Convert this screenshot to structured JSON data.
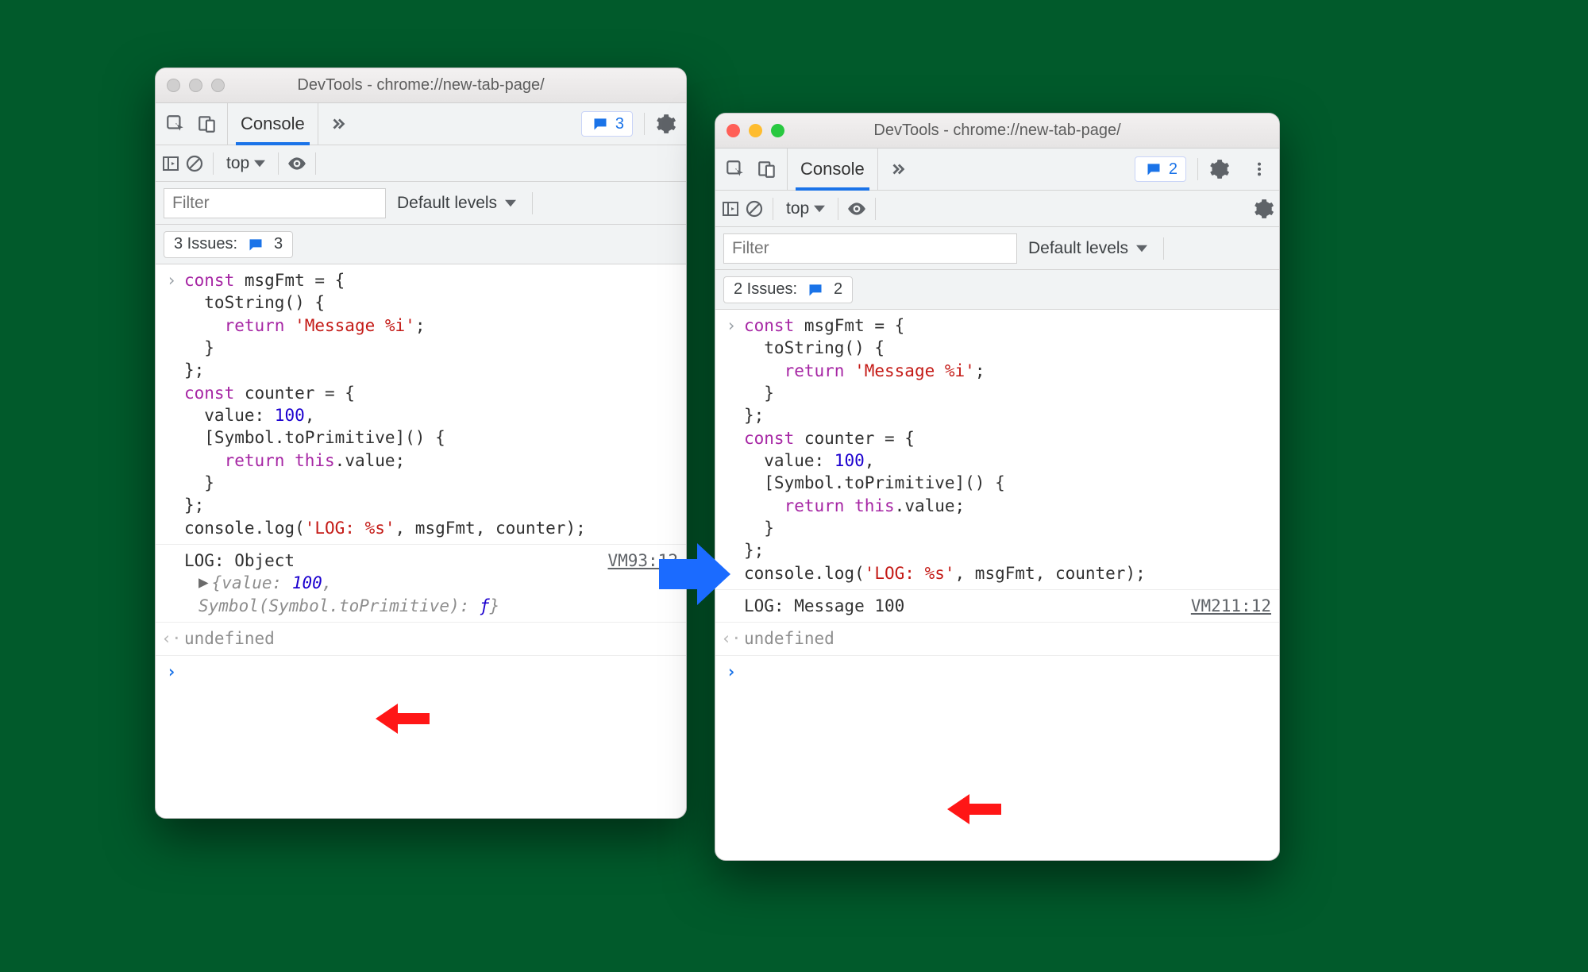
{
  "left": {
    "title": "DevTools - chrome://new-tab-page/",
    "tab": "Console",
    "message_count": "3",
    "context": "top",
    "filter_placeholder": "Filter",
    "levels_label": "Default levels",
    "issues_label": "3 Issues:",
    "issues_count": "3",
    "output_text": "LOG: Object",
    "output_link": "VM93:12",
    "object_preview_prefix": "{value: ",
    "object_preview_value": "100",
    "object_preview_mid": ", Symbol(Symbol.toPrimitive): ",
    "object_preview_fn": "ƒ",
    "object_preview_suffix": "}",
    "return_value": "undefined"
  },
  "right": {
    "title": "DevTools - chrome://new-tab-page/",
    "tab": "Console",
    "message_count": "2",
    "context": "top",
    "filter_placeholder": "Filter",
    "levels_label": "Default levels",
    "issues_label": "2 Issues:",
    "issues_count": "2",
    "output_text": "LOG: Message 100",
    "output_link": "VM211:12",
    "return_value": "undefined"
  },
  "code": {
    "l1a": "const",
    "l1b": " msgFmt = {",
    "l2": "  toString() {",
    "l3a": "    ",
    "l3b": "return",
    "l3c": " ",
    "l3d": "'Message %i'",
    "l3e": ";",
    "l4": "  }",
    "l5": "};",
    "l6a": "const",
    "l6b": " counter = {",
    "l7a": "  value: ",
    "l7b": "100",
    "l7c": ",",
    "l8": "  [Symbol.toPrimitive]() {",
    "l9a": "    ",
    "l9b": "return",
    "l9c": " ",
    "l9d": "this",
    "l9e": ".value;",
    "l10": "  }",
    "l11": "};",
    "l12a": "console.log(",
    "l12b": "'LOG: %s'",
    "l12c": ", msgFmt, counter);"
  }
}
